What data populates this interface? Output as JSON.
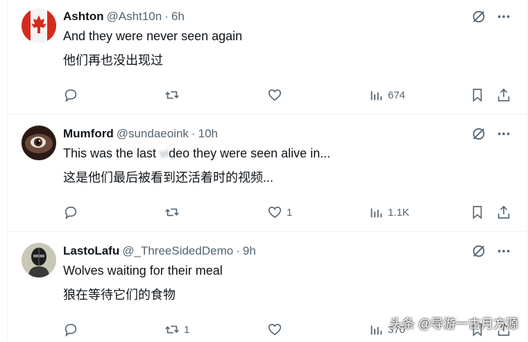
{
  "tweets": [
    {
      "name": "Ashton",
      "handle": "@Asht10n",
      "time": "6h",
      "text_en": "And they were never seen again",
      "text_zh": "他们再也没出现过",
      "reply_count": "",
      "retweet_count": "",
      "like_count": "",
      "view_count": "674"
    },
    {
      "name": "Mumford",
      "handle": "@sundaeoink",
      "time": "10h",
      "text_en_a": "This was the last ",
      "text_en_blur": "vi",
      "text_en_b": "deo they were seen alive in...",
      "text_zh": "这是他们最后被看到还活着时的视频...",
      "reply_count": "",
      "retweet_count": "",
      "like_count": "1",
      "view_count": "1.1K"
    },
    {
      "name": "LastoLafu",
      "handle": "@_ThreeSidedDemo",
      "time": "9h",
      "text_en": "Wolves waiting for their meal",
      "text_zh": "狼在等待它们的食物",
      "reply_count": "",
      "retweet_count": "1",
      "like_count": "",
      "view_count": "370"
    }
  ],
  "separator": "·",
  "watermark": "头条 @导游一古月方源",
  "icons": {
    "reply": "reply-icon",
    "retweet": "retweet-icon",
    "like": "like-icon",
    "views": "views-icon",
    "bookmark": "bookmark-icon",
    "share": "share-icon",
    "grok": "grok-icon",
    "more": "more-icon"
  },
  "colors": {
    "text": "#0f1419",
    "muted": "#536471",
    "border": "#eff3f4"
  }
}
